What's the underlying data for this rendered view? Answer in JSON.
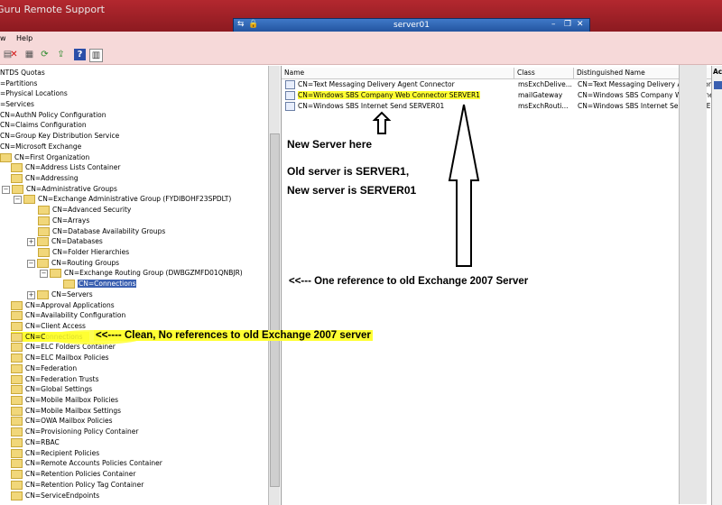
{
  "window": {
    "title": "Guru Remote Support",
    "rdp_bar": {
      "title": "server01"
    }
  },
  "menu": {
    "items": [
      "w",
      "Help"
    ]
  },
  "toolbar": {
    "icons": [
      "delete-icon",
      "properties-icon",
      "refresh-icon",
      "export-icon",
      "help-icon",
      "view-icon"
    ]
  },
  "tree": {
    "items": [
      {
        "label": "NTDS Quotas"
      },
      {
        "label": "=Partitions"
      },
      {
        "label": "=Physical Locations"
      },
      {
        "label": "=Services"
      },
      {
        "label": "CN=AuthN Policy Configuration"
      },
      {
        "label": "CN=Claims Configuration"
      },
      {
        "label": "CN=Group Key Distribution Service"
      },
      {
        "label": "CN=Microsoft Exchange"
      },
      {
        "label": "CN=First Organization"
      },
      {
        "label": "CN=Address Lists Container"
      },
      {
        "label": "CN=Addressing"
      },
      {
        "label": "CN=Administrative Groups"
      },
      {
        "label": "CN=Exchange Administrative Group (FYDIBOHF23SPDLT)"
      },
      {
        "label": "CN=Advanced Security"
      },
      {
        "label": "CN=Arrays"
      },
      {
        "label": "CN=Database Availability Groups"
      },
      {
        "label": "CN=Databases"
      },
      {
        "label": "CN=Folder Hierarchies"
      },
      {
        "label": "CN=Routing Groups"
      },
      {
        "label": "CN=Exchange Routing Group (DWBGZMFD01QNBJR)"
      },
      {
        "label": "CN=Connections"
      },
      {
        "label": "CN=Servers"
      },
      {
        "label": "CN=Approval Applications"
      },
      {
        "label": "CN=Availability Configuration"
      },
      {
        "label": "CN=Client Access"
      },
      {
        "label": "CN=Connections"
      },
      {
        "label": "CN=ELC Folders Container"
      },
      {
        "label": "CN=ELC Mailbox Policies"
      },
      {
        "label": "CN=Federation"
      },
      {
        "label": "CN=Federation Trusts"
      },
      {
        "label": "CN=Global Settings"
      },
      {
        "label": "CN=Mobile Mailbox Policies"
      },
      {
        "label": "CN=Mobile Mailbox Settings"
      },
      {
        "label": "CN=OWA Mailbox Policies"
      },
      {
        "label": "CN=Provisioning Policy Container"
      },
      {
        "label": "CN=RBAC"
      },
      {
        "label": "CN=Recipient Policies"
      },
      {
        "label": "CN=Remote Accounts Policies Container"
      },
      {
        "label": "CN=Retention Policies Container"
      },
      {
        "label": "CN=Retention Policy Tag Container"
      },
      {
        "label": "CN=ServiceEndpoints"
      }
    ]
  },
  "list": {
    "columns": [
      "Name",
      "Class",
      "Distinguished Name"
    ],
    "rows": [
      {
        "name": "CN=Text Messaging Delivery Agent Connector",
        "class": "msExchDelive...",
        "dn": "CN=Text Messaging Delivery Agent Conn"
      },
      {
        "name": "CN=Windows SBS Company Web Connector SERVER1",
        "class": "mailGateway",
        "dn": "CN=Windows SBS Company Web Connec"
      },
      {
        "name": "CN=Windows SBS Internet Send SERVER01",
        "class": "msExchRouti...",
        "dn": "CN=Windows SBS Internet Send SERVER"
      }
    ]
  },
  "actions_pane": {
    "header": "Ac"
  },
  "annotations": {
    "new_server": "New Server here",
    "old_server": "Old server is SERVER1,",
    "new_server_name": "New server is SERVER01",
    "one_reference": "<<--- One reference to old Exchange 2007 Server",
    "clean": "<<---- Clean, No references to old Exchange 2007 server"
  }
}
